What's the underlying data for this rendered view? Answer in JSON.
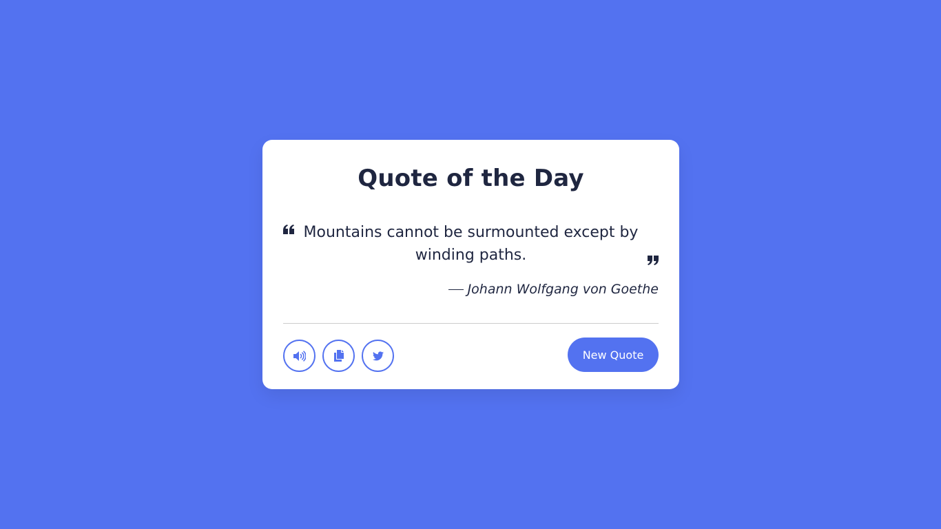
{
  "header": {
    "title": "Quote of the Day"
  },
  "quote": {
    "text": "Mountains cannot be surmounted except by winding paths.",
    "author": "Johann Wolfgang von Goethe",
    "open_icon": "quote-left-icon",
    "close_icon": "quote-right-icon"
  },
  "actions": {
    "icons": [
      "speaker-icon",
      "copy-icon",
      "twitter-icon"
    ],
    "new_quote_label": "New Quote"
  },
  "colors": {
    "background": "#5372f0",
    "accent": "#5372f0",
    "text": "#1f2640",
    "card": "#ffffff"
  }
}
